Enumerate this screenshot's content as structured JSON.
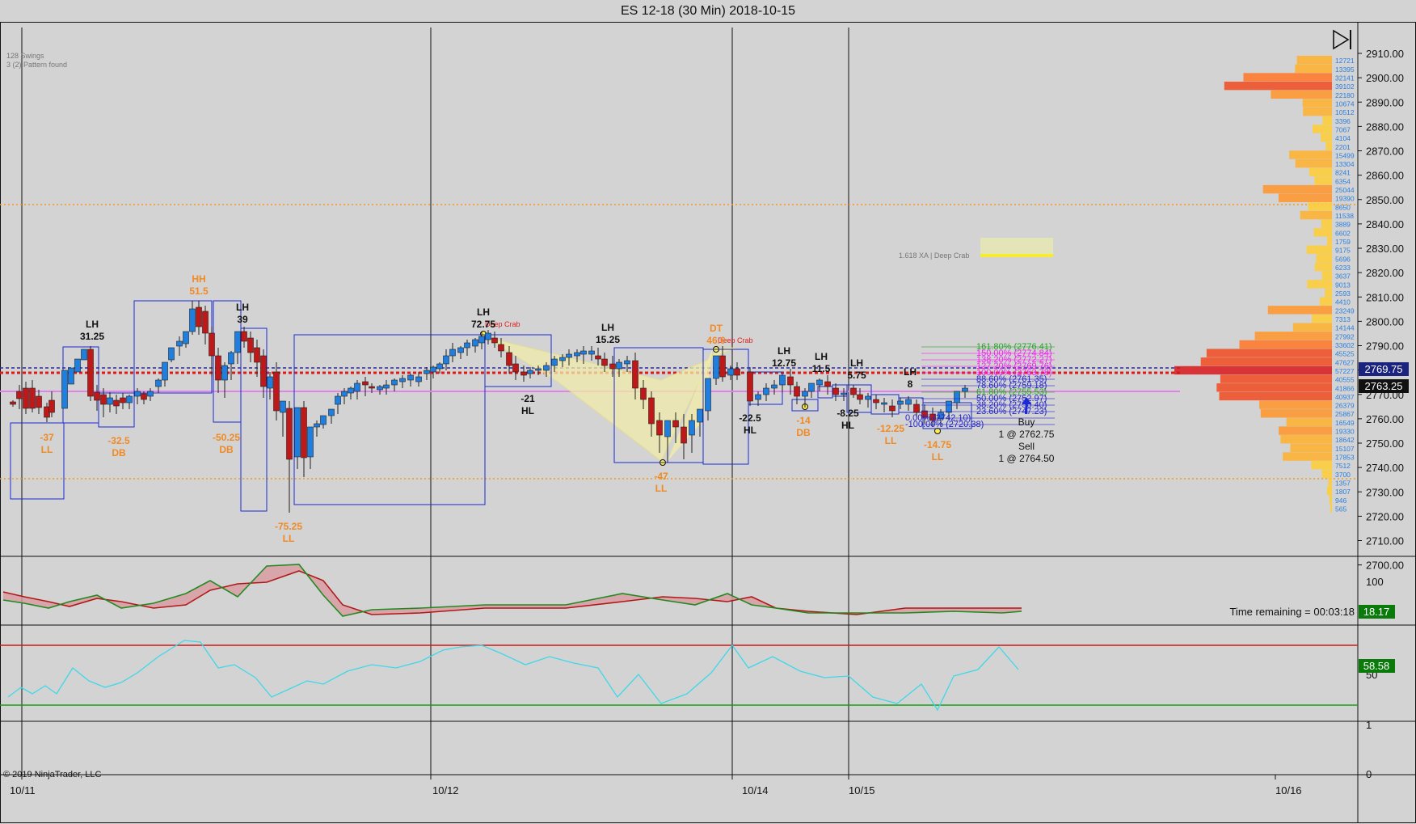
{
  "window": {
    "title": "ES 12-18 (30 Min)  2018-10-15"
  },
  "info": {
    "swings": "128 Swings",
    "pattern": "3 (2) Pattern found",
    "copyright": "© 2019 NinjaTrader, LLC"
  },
  "icons": {
    "playback": "skip-end-icon",
    "buy_arrow": "arrow-up-icon"
  },
  "colors": {
    "background": "#d3d3d3",
    "up_candle": "#1e7fe0",
    "down_candle": "#c01818",
    "swing_box": "#1a2bd6",
    "label_orange": "#f08a24",
    "label_dark": "#111111",
    "pattern_fill": "#f2ecaa",
    "histogram_text": "#2a7fe0"
  },
  "price_axis": {
    "ticks": [
      "2910.00",
      "2900.00",
      "2890.00",
      "2880.00",
      "2870.00",
      "2860.00",
      "2850.00",
      "2840.00",
      "2830.00",
      "2820.00",
      "2810.00",
      "2800.00",
      "2790.00",
      "2780.00",
      "2770.00",
      "2760.00",
      "2750.00",
      "2740.00",
      "2730.00",
      "2720.00",
      "2710.00",
      "2700.00"
    ],
    "last_price": "2769.75",
    "bid_price": "2763.25"
  },
  "time_axis": {
    "labels": [
      "10/11",
      "10/12",
      "10/14",
      "10/15",
      "10/16"
    ]
  },
  "volume_profile": {
    "values": [
      "12721",
      "13395",
      "32141",
      "39102",
      "22180",
      "10674",
      "10512",
      "3396",
      "7067",
      "4104",
      "2201",
      "15499",
      "13304",
      "8241",
      "6354",
      "25044",
      "19390",
      "8650",
      "11538",
      "3889",
      "6602",
      "1759",
      "9175",
      "5696",
      "6233",
      "3637",
      "9013",
      "2593",
      "4410",
      "23249",
      "7313",
      "14144",
      "27992",
      "33602",
      "45525",
      "47627",
      "57227",
      "40555",
      "41866",
      "40937",
      "26379",
      "25867",
      "16549",
      "19330",
      "18642",
      "15107",
      "17853",
      "7512",
      "3700",
      "1357",
      "1807",
      "946",
      "565"
    ]
  },
  "swing_labels": [
    {
      "v": "-37",
      "t": "LL",
      "c": "o"
    },
    {
      "v": "LH",
      "t": "31.25",
      "c": "d"
    },
    {
      "v": "-32.5",
      "t": "DB",
      "c": "o"
    },
    {
      "v": "HH",
      "t": "51.5",
      "c": "o"
    },
    {
      "v": "-50.25",
      "t": "DB",
      "c": "o"
    },
    {
      "v": "LH",
      "t": "39",
      "c": "d"
    },
    {
      "v": "-75.25",
      "t": "LL",
      "c": "o"
    },
    {
      "v": "LH",
      "t": "72.75",
      "c": "d"
    },
    {
      "v": "-21",
      "t": "HL",
      "c": "d"
    },
    {
      "v": "LH",
      "t": "15.25",
      "c": "d"
    },
    {
      "v": "-47",
      "t": "LL",
      "c": "o"
    },
    {
      "v": "DT",
      "t": "46.0",
      "c": "o"
    },
    {
      "v": "-22.5",
      "t": "HL",
      "c": "d"
    },
    {
      "v": "LH",
      "t": "12.75",
      "c": "d"
    },
    {
      "v": "-14",
      "t": "DB",
      "c": "o"
    },
    {
      "v": "LH",
      "t": "11.5",
      "c": "d"
    },
    {
      "v": "-8.25",
      "t": "HL",
      "c": "d"
    },
    {
      "v": "LH",
      "t": "5.75",
      "c": "d"
    },
    {
      "v": "-12.25",
      "t": "LL",
      "c": "o"
    },
    {
      "v": "LH",
      "t": "8",
      "c": "d"
    },
    {
      "v": "-14.75",
      "t": "LL",
      "c": "o"
    }
  ],
  "pattern_labels": {
    "crab1": "Deep Crab",
    "crab2": "Deep Crab",
    "crab_target": "1.618 XA | Deep Crab"
  },
  "fib_labels": [
    "161.80% (2776.41)",
    "150.00% (2774.84)",
    "138.20% (2772.27)",
    "127.20% (2769.76)",
    "100.00% (2763.78)",
    "88.60% (2761.35)",
    "78.60% (2759.18)",
    "61.80% (2755.53)",
    "50.00% (2752.97)",
    "38.20% (2750.40)",
    "23.60% (2747.23)",
    "0.00% (2742.10)",
    "-100.00% (2720.38)"
  ],
  "orders": {
    "buy_label": "Buy",
    "buy_fill": "1 @ 2762.75",
    "sell_label": "Sell",
    "sell_fill": "1 @ 2764.50"
  },
  "panel2": {
    "axis": [
      "100",
      "0"
    ],
    "value": "18.17",
    "time_remaining": "Time remaining = 00:03:18"
  },
  "panel3": {
    "axis": [
      "50"
    ],
    "value": "58.58"
  },
  "panel4": {
    "axis": [
      "1",
      "0"
    ]
  }
}
